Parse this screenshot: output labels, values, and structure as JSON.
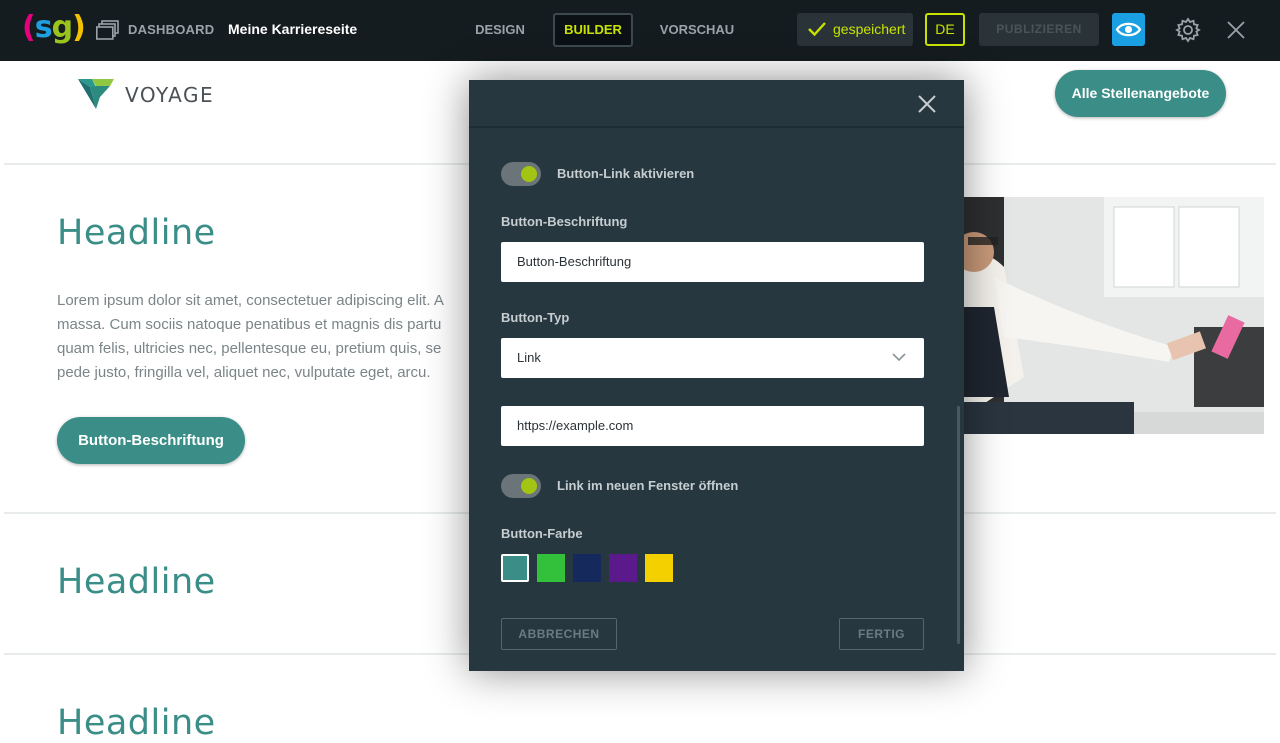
{
  "topbar": {
    "logo": "(sg)",
    "dashboard_label": "DASHBOARD",
    "site_title": "Meine Karriereseite",
    "tabs": [
      {
        "label": "DESIGN",
        "active": false
      },
      {
        "label": "BUILDER",
        "active": true
      },
      {
        "label": "VORSCHAU",
        "active": false
      }
    ],
    "saved_label": "gespeichert",
    "language": "DE",
    "publish_label": "PUBLIZIEREN",
    "icons": [
      "dashboard-icon",
      "check-icon",
      "eye-icon",
      "gear-icon",
      "close-icon"
    ]
  },
  "site": {
    "brand": "VOYAGE",
    "jobs_button": "Alle Stellenangebote",
    "sections": [
      {
        "headline": "Headline"
      },
      {
        "headline": "Headline"
      },
      {
        "headline": "Headline"
      }
    ],
    "body_lines": [
      "Lorem ipsum dolor sit amet, consectetuer adipiscing elit. A",
      "massa. Cum sociis natoque penatibus et magnis dis partu",
      "quam felis, ultricies nec, pellentesque eu, pretium quis, se",
      "pede justo, fringilla vel, aliquet nec, vulputate eget, arcu."
    ],
    "content_button": "Button-Beschriftung"
  },
  "modal": {
    "toggle_link_label": "Button-Link aktivieren",
    "toggle_link_on": true,
    "caption_label": "Button-Beschriftung",
    "caption_value": "Button-Beschriftung",
    "type_label": "Button-Typ",
    "type_value": "Link",
    "url_value": "https://example.com",
    "toggle_newwindow_label": "Link im neuen Fenster öffnen",
    "toggle_newwindow_on": true,
    "color_label": "Button-Farbe",
    "colors": [
      "#3a8e87",
      "#33c13c",
      "#15295c",
      "#5a1a8c",
      "#f5d000"
    ],
    "selected_color_index": 0,
    "cancel_label": "ABBRECHEN",
    "done_label": "FERTIG"
  },
  "colors": {
    "topbar_bg": "#151c20",
    "accent_lime": "#c9e300",
    "brand_teal": "#3a8e87",
    "modal_bg": "#263740",
    "preview_blue": "#1aa0e2"
  }
}
